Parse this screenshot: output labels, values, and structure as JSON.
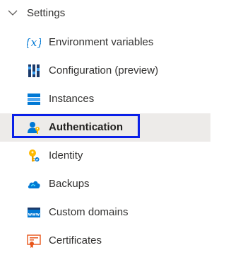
{
  "group": {
    "label": "Settings",
    "expanded": true,
    "icon": "chevron-down-icon"
  },
  "items": [
    {
      "label": "Environment variables",
      "icon": "variable-icon",
      "selected": false
    },
    {
      "label": "Configuration (preview)",
      "icon": "configuration-icon",
      "selected": false
    },
    {
      "label": "Instances",
      "icon": "instances-icon",
      "selected": false
    },
    {
      "label": "Authentication",
      "icon": "authentication-icon",
      "selected": true
    },
    {
      "label": "Identity",
      "icon": "identity-key-icon",
      "selected": false
    },
    {
      "label": "Backups",
      "icon": "backup-cloud-icon",
      "selected": false
    },
    {
      "label": "Custom domains",
      "icon": "custom-domains-icon",
      "selected": false
    },
    {
      "label": "Certificates",
      "icon": "certificate-icon",
      "selected": false
    }
  ],
  "colors": {
    "selected_background": "#edebe9",
    "focus_outline": "#0a20e8",
    "azure_blue": "#0078d4"
  }
}
